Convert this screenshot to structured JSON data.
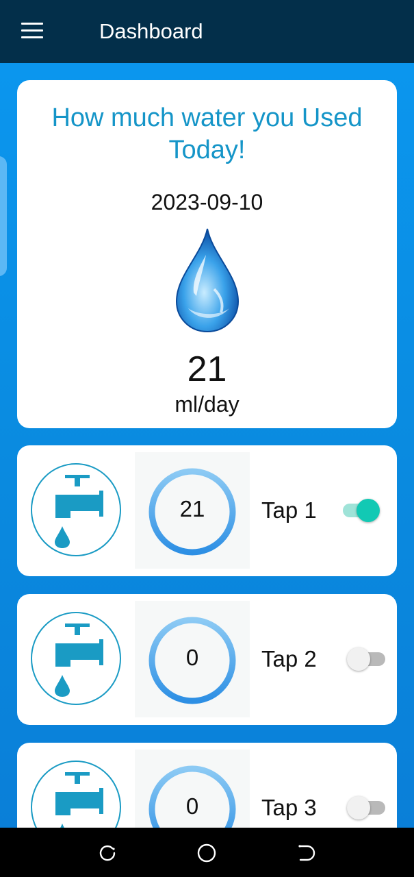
{
  "appbar": {
    "title": "Dashboard",
    "menu_icon": "hamburger-menu-icon"
  },
  "summary": {
    "title": "How much water you Used Today!",
    "date": "2023-09-10",
    "value": "21",
    "unit": "ml/day",
    "icon": "water-drop-icon"
  },
  "taps": [
    {
      "label": "Tap 1",
      "value": "21",
      "enabled": true,
      "icon": "faucet-icon"
    },
    {
      "label": "Tap 2",
      "value": "0",
      "enabled": false,
      "icon": "faucet-icon"
    },
    {
      "label": "Tap 3",
      "value": "0",
      "enabled": false,
      "icon": "faucet-icon"
    }
  ],
  "navbar": {
    "buttons": [
      "recent-apps-icon",
      "home-icon",
      "back-icon"
    ]
  },
  "colors": {
    "appbar": "#032f4a",
    "background": "#0a8ae0",
    "accent": "#1595c8",
    "toggle_on": "#12c9b4"
  }
}
